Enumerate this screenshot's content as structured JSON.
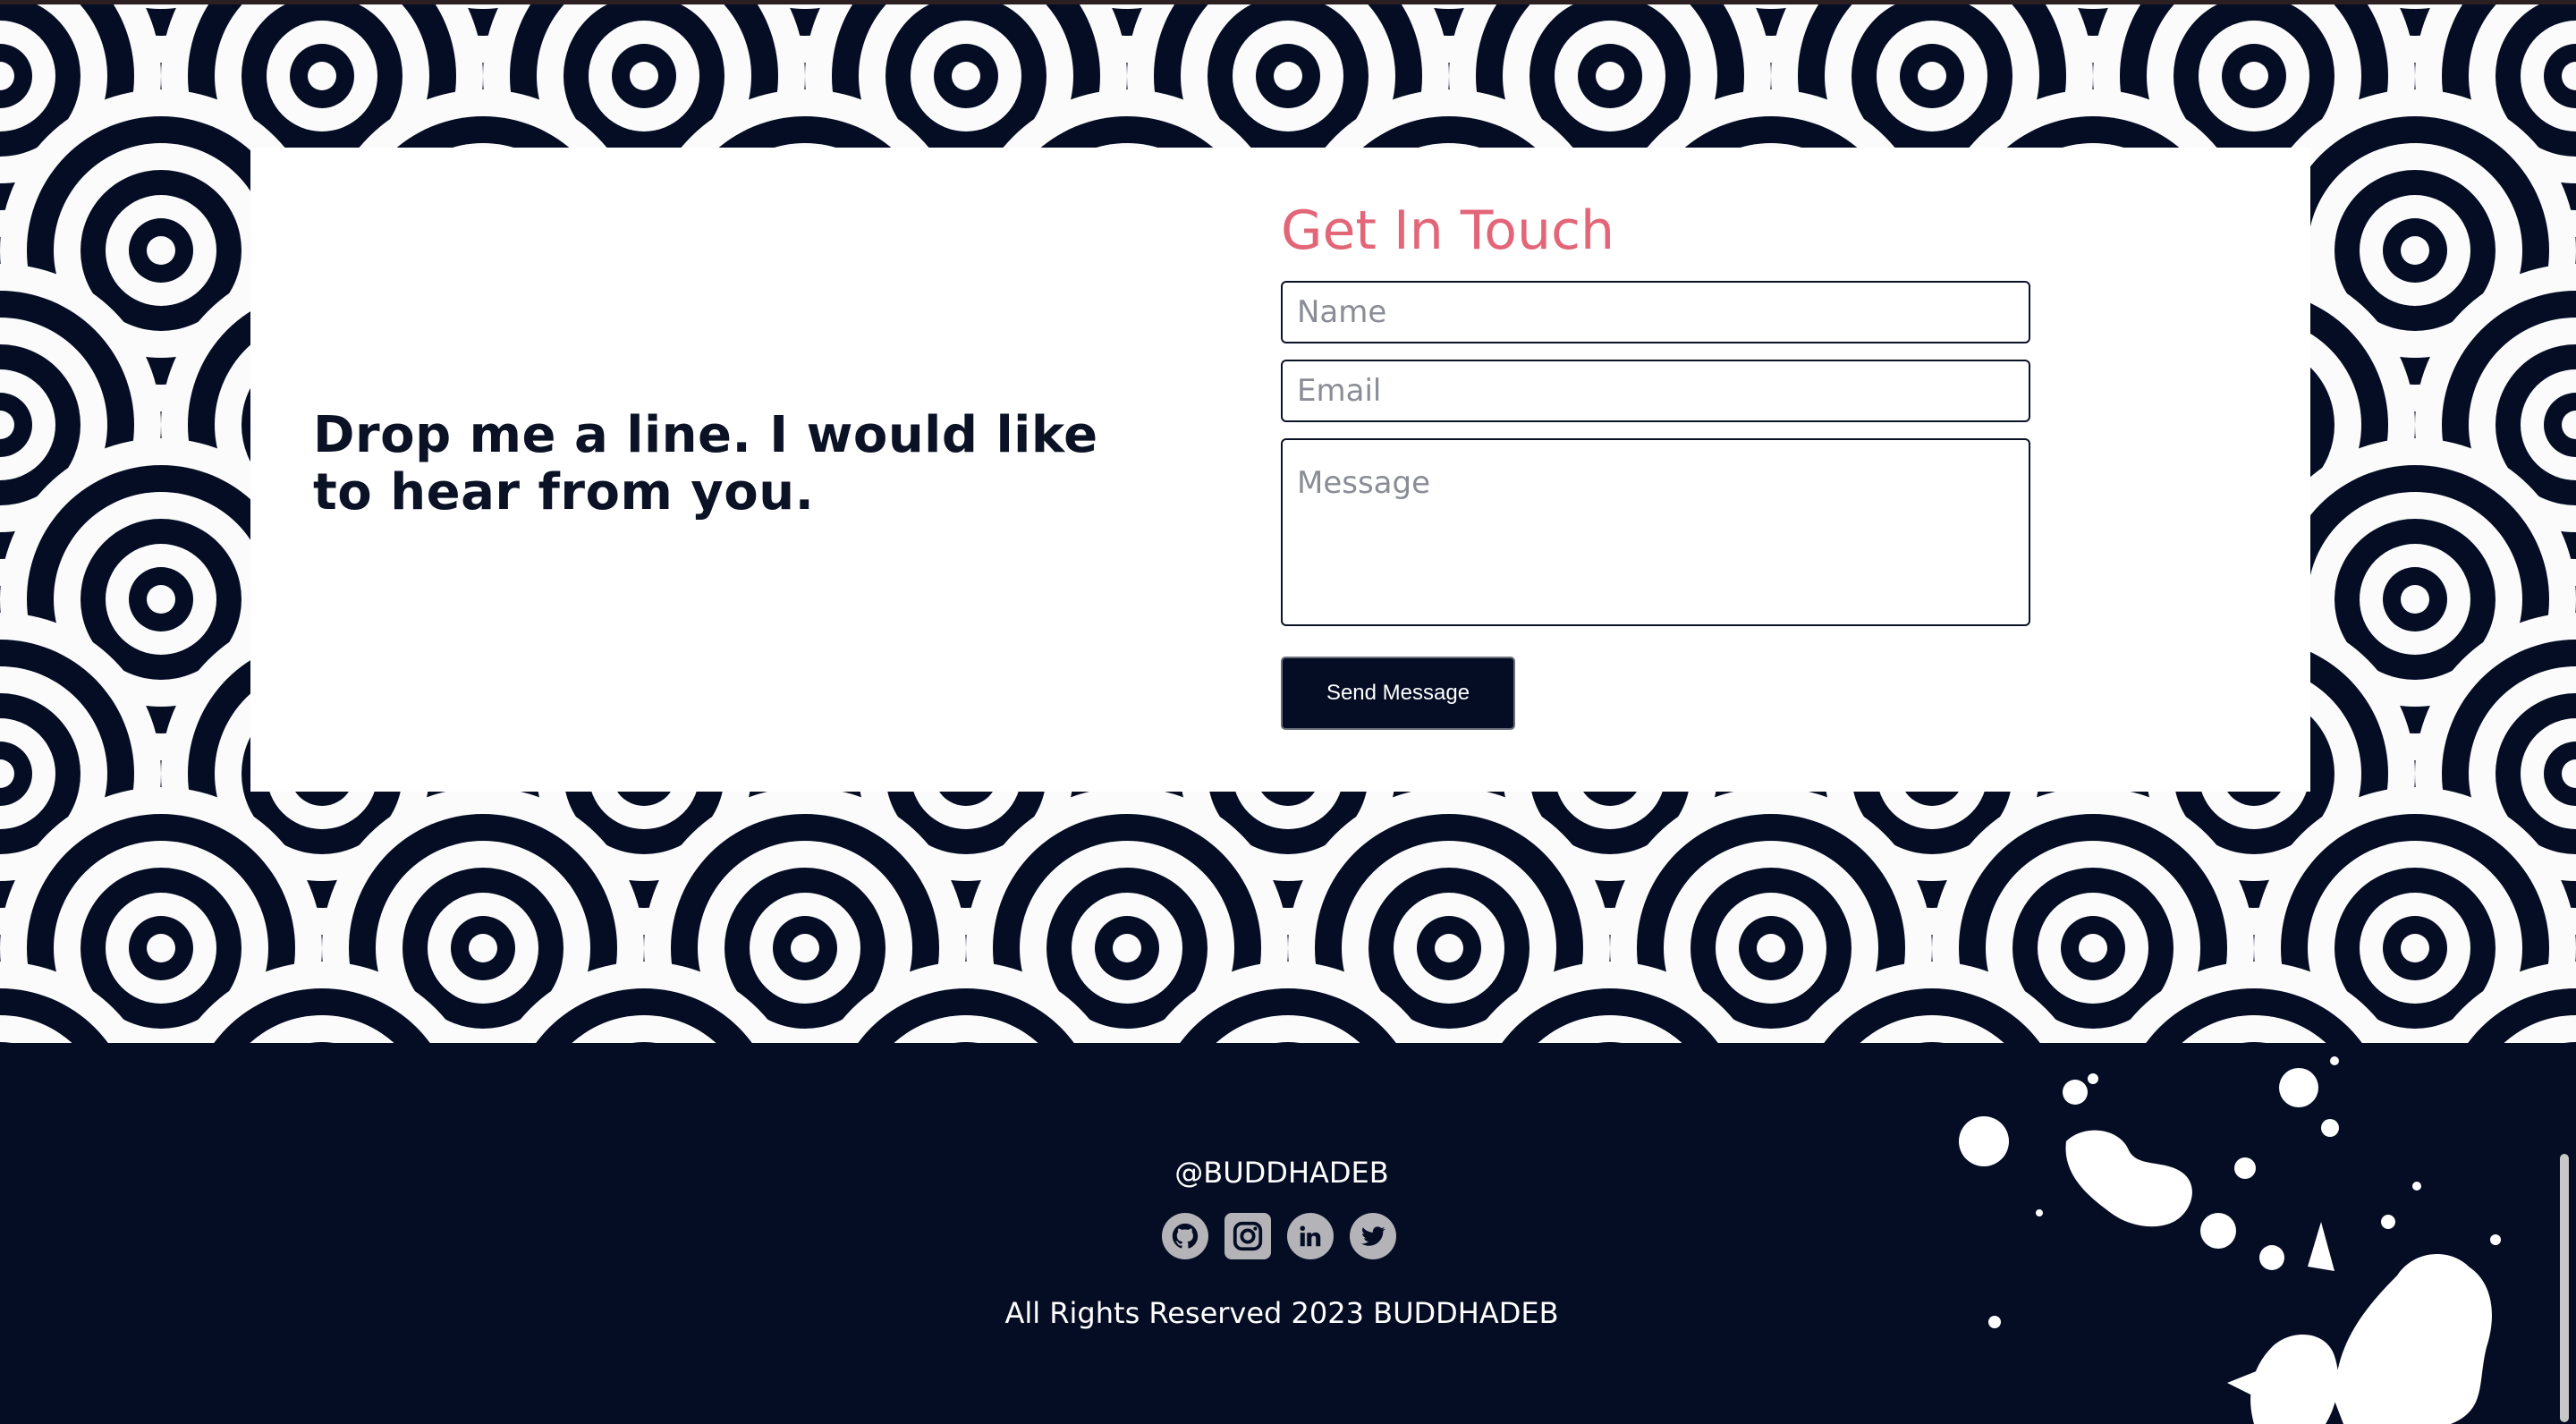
{
  "contact": {
    "tagline": "Drop me a line. I would like to hear from you.",
    "form_title": "Get In Touch",
    "name_placeholder": "Name",
    "email_placeholder": "Email",
    "message_placeholder": "Message",
    "send_label": "Send Message"
  },
  "footer": {
    "handle": "@BUDDHADEB",
    "copyright": "All Rights Reserved 2023 BUDDHADEB",
    "social_icons": [
      "github-icon",
      "instagram-icon",
      "linkedin-icon",
      "twitter-icon"
    ]
  },
  "colors": {
    "navy": "#040d24",
    "accent_pink": "#e26677",
    "white": "#ffffff",
    "icon_grey": "#b3b3b8"
  }
}
